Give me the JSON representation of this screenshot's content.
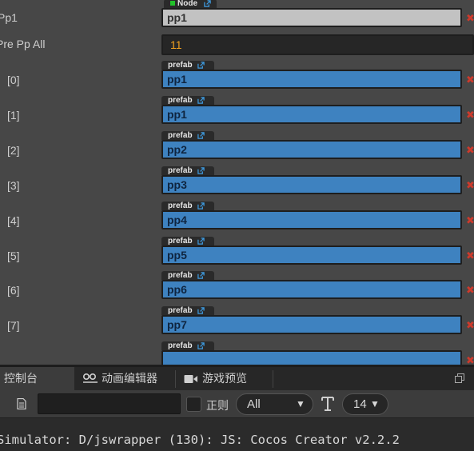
{
  "inspector": {
    "pp1": {
      "label": "Pp1",
      "tag": "Node",
      "value": "pp1"
    },
    "pre_pp_all": {
      "label": "Pre Pp All",
      "value": "11"
    },
    "items": [
      {
        "label": "[0]",
        "tag": "prefab",
        "value": "pp1"
      },
      {
        "label": "[1]",
        "tag": "prefab",
        "value": "pp1"
      },
      {
        "label": "[2]",
        "tag": "prefab",
        "value": "pp2"
      },
      {
        "label": "[3]",
        "tag": "prefab",
        "value": "pp3"
      },
      {
        "label": "[4]",
        "tag": "prefab",
        "value": "pp4"
      },
      {
        "label": "[5]",
        "tag": "prefab",
        "value": "pp5"
      },
      {
        "label": "[6]",
        "tag": "prefab",
        "value": "pp6"
      },
      {
        "label": "[7]",
        "tag": "prefab",
        "value": "pp7"
      },
      {
        "label": "",
        "tag": "prefab",
        "value": ""
      }
    ],
    "remove_glyph": "✖"
  },
  "tabs": [
    {
      "label": "控制台",
      "icon": "",
      "active": true
    },
    {
      "label": "动画编辑器",
      "icon": "animation-icon",
      "active": false
    },
    {
      "label": "游戏预览",
      "icon": "camera-icon",
      "active": false
    }
  ],
  "toolbar": {
    "search_value": "",
    "regex_label": "正则",
    "level_value": "All",
    "font_size_value": "14"
  },
  "console": {
    "line": "Simulator: D/jswrapper (130): JS: Cocos Creator v2.2.2"
  },
  "colors": {
    "background": "#474747",
    "prefab_field": "#3e82c0",
    "node_field": "#c2c2c2",
    "number_text": "#f0a020",
    "remove": "#cd3a2c"
  }
}
